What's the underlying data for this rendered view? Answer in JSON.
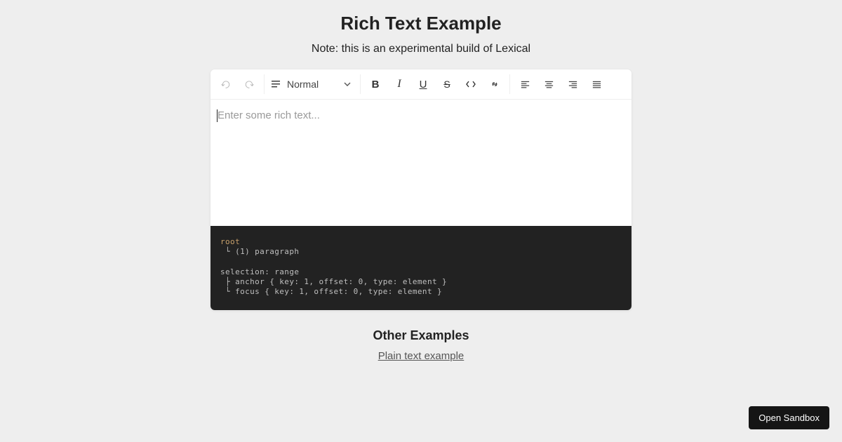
{
  "title": "Rich Text Example",
  "note": "Note: this is an experimental build of Lexical",
  "toolbar": {
    "block_type_label": "Normal"
  },
  "editor": {
    "placeholder": "Enter some rich text..."
  },
  "debug": {
    "text": "root\n └ (1) paragraph\n\nselection: range\n ├ anchor { key: 1, offset: 0, type: element }\n └ focus { key: 1, offset: 0, type: element }"
  },
  "other_heading": "Other Examples",
  "links": {
    "plain_text": "Plain text example"
  },
  "sandbox_button": "Open Sandbox"
}
